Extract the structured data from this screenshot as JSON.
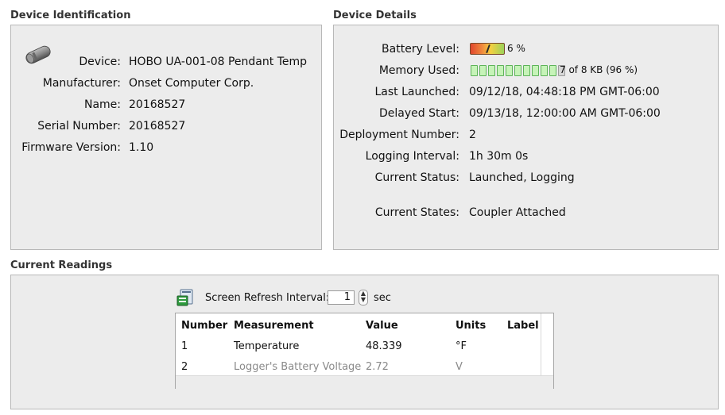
{
  "sections": {
    "device_identification": "Device Identification",
    "device_details": "Device Details",
    "current_readings": "Current Readings"
  },
  "identification": {
    "device_label": "Device:",
    "device_value": "HOBO UA-001-08 Pendant Temp",
    "manufacturer_label": "Manufacturer:",
    "manufacturer_value": "Onset Computer Corp.",
    "name_label": "Name:",
    "name_value": "20168527",
    "serial_label": "Serial Number:",
    "serial_value": "20168527",
    "firmware_label": "Firmware Version:",
    "firmware_value": "1.10"
  },
  "details": {
    "battery_label": "Battery Level:",
    "battery_value": "6 %",
    "battery_level": 0.06,
    "memory_label": "Memory Used:",
    "memory_value": "7 of 8 KB (96 %)",
    "memory_used_fraction": 0.96,
    "memory_cells_filled": 10,
    "memory_cells_total": 11,
    "last_launched_label": "Last Launched:",
    "last_launched_value": "09/12/18, 04:48:18 PM GMT-06:00",
    "delayed_start_label": "Delayed Start:",
    "delayed_start_value": "09/13/18, 12:00:00 AM GMT-06:00",
    "deployment_label": "Deployment Number:",
    "deployment_value": "2",
    "logging_interval_label": "Logging Interval:",
    "logging_interval_value": "1h 30m 0s",
    "current_status_label": "Current Status:",
    "current_status_value": "Launched, Logging",
    "current_states_label": "Current States:",
    "current_states_value": "Coupler Attached"
  },
  "readings": {
    "refresh_label": "Screen Refresh Interval:",
    "refresh_value": "1",
    "refresh_unit": "sec",
    "columns": [
      "Number",
      "Measurement",
      "Value",
      "Units",
      "Label"
    ],
    "rows": [
      {
        "number": "1",
        "measurement": "Temperature",
        "value": "48.339",
        "units": "°F",
        "label": ""
      },
      {
        "number": "2",
        "measurement": "Logger's Battery Voltage",
        "value": "2.72",
        "units": "V",
        "label": ""
      }
    ]
  },
  "icons": {
    "device": "device-icon",
    "refresh": "refresh-icon",
    "stepper": "stepper-icon"
  },
  "colors": {
    "panel_bg": "#ececec",
    "panel_border": "#b8b8b8",
    "memory_cell": "#c6f3b8",
    "battery_low": "#e0472d"
  }
}
